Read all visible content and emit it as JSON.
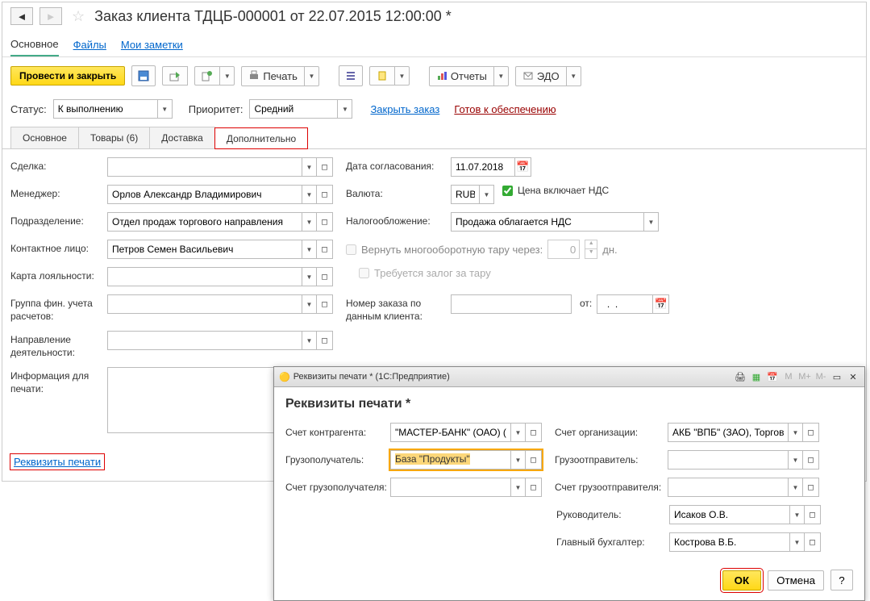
{
  "title": "Заказ клиента ТДЦБ-000001 от 22.07.2015 12:00:00 *",
  "nav_tabs": {
    "main": "Основное",
    "files": "Файлы",
    "notes": "Мои заметки"
  },
  "toolbar": {
    "post_close": "Провести и закрыть",
    "print": "Печать",
    "reports": "Отчеты",
    "edo": "ЭДО"
  },
  "status": {
    "label": "Статус:",
    "value": "К выполнению"
  },
  "priority": {
    "label": "Приоритет:",
    "value": "Средний"
  },
  "close_order": "Закрыть заказ",
  "ready_supply": "Готов к обеспечению",
  "sub_tabs": {
    "main": "Основное",
    "goods": "Товары (6)",
    "delivery": "Доставка",
    "additional": "Дополнительно"
  },
  "fields": {
    "deal": "Сделка:",
    "manager": "Менеджер:",
    "manager_val": "Орлов Александр Владимирович",
    "dept": "Подразделение:",
    "dept_val": "Отдел продаж торгового направления",
    "contact": "Контактное лицо:",
    "contact_val": "Петров Семен Васильевич",
    "loyalty": "Карта лояльности:",
    "fin_group": "Группа фин. учета расчетов:",
    "activity": "Направление деятельности:",
    "print_info": "Информация для печати:",
    "agree_date": "Дата согласования:",
    "agree_date_val": "11.07.2018",
    "currency": "Валюта:",
    "currency_val": "RUB",
    "vat_included": "Цена включает НДС",
    "taxation": "Налогообложение:",
    "taxation_val": "Продажа облагается НДС",
    "return_tara": "Вернуть многооборотную тару через:",
    "days0": "0",
    "days_unit": "дн.",
    "deposit": "Требуется залог за тару",
    "client_num": "Номер заказа по данным клиента:",
    "ot": "от:",
    "date_mask": "  .  .    "
  },
  "print_requisites": "Реквизиты печати",
  "dialog": {
    "title_bar": "Реквизиты печати *  (1С:Предприятие)",
    "heading": "Реквизиты печати *",
    "counteragent_acc": "Счет контрагента:",
    "counteragent_acc_val": "\"МАСТЕР-БАНК\" (ОАО) (I",
    "consignee": "Грузополучатель:",
    "consignee_val": "База \"Продукты\"",
    "consignee_acc": "Счет грузополучателя:",
    "org_acc": "Счет организации:",
    "org_acc_val": "АКБ \"ВПБ\" (ЗАО), Торгов",
    "shipper": "Грузоотправитель:",
    "shipper_acc": "Счет грузоотправителя:",
    "head": "Руководитель:",
    "head_val": "Исаков О.В.",
    "accountant": "Главный бухгалтер:",
    "accountant_val": "Кострова В.Б.",
    "ok": "ОК",
    "cancel": "Отмена",
    "help": "?"
  }
}
